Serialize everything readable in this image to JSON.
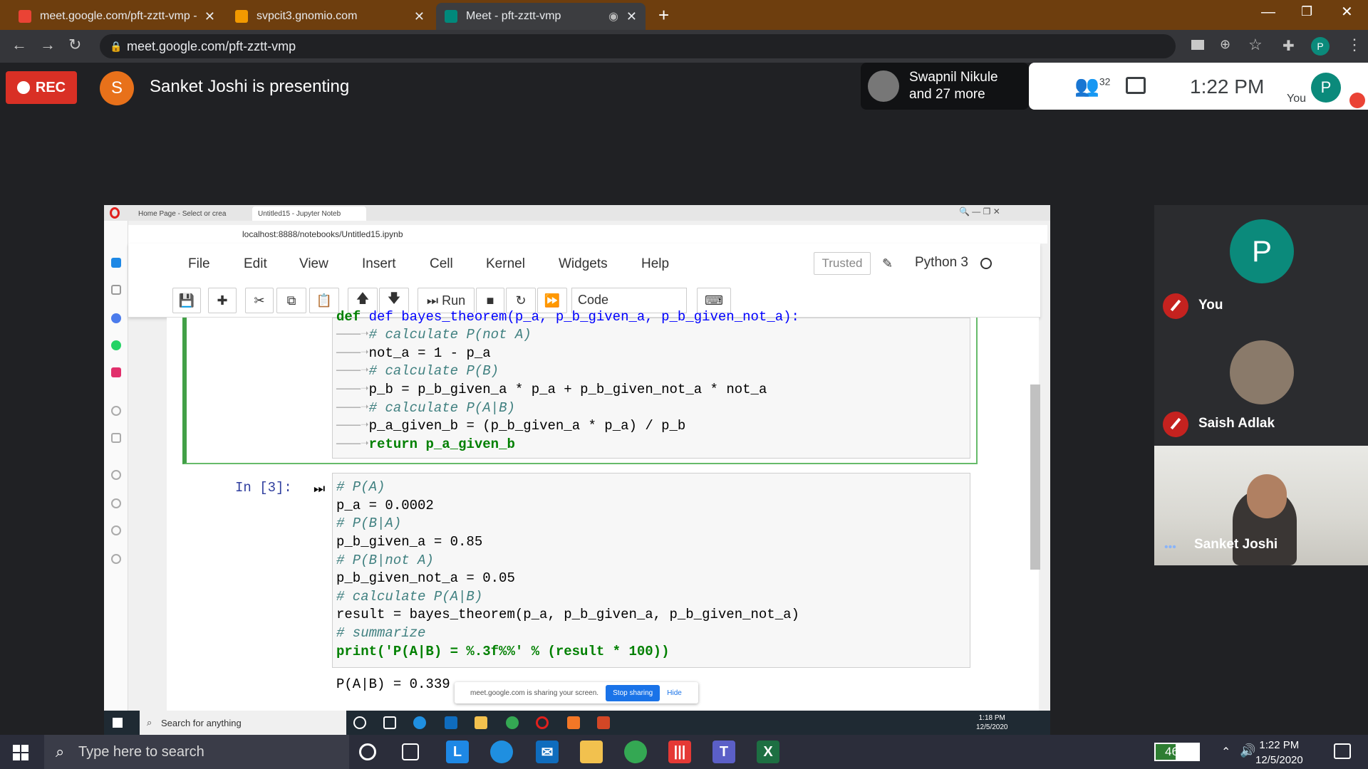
{
  "browser": {
    "tabs": [
      {
        "label": "meet.google.com/pft-zztt-vmp -",
        "active": false
      },
      {
        "label": "svpcit3.gnomio.com",
        "active": false
      },
      {
        "label": "Meet - pft-zztt-vmp",
        "active": true
      }
    ],
    "url": "meet.google.com/pft-zztt-vmp"
  },
  "meet": {
    "rec_label": "REC",
    "presenter_initial": "S",
    "presenter_text": "Sanket Joshi is presenting",
    "participants_preview": {
      "line1": "Swapnil Nikule",
      "line2": "and 27 more"
    },
    "participant_count": "32",
    "time": "1:22 PM",
    "you_label": "You",
    "you_initial": "P",
    "tiles": [
      {
        "name": "You",
        "initial": "P",
        "muted": true
      },
      {
        "name": "Saish Adlak",
        "muted": true
      },
      {
        "name": "Sanket Joshi",
        "video": true
      }
    ]
  },
  "shared": {
    "inner_tabs": [
      "Home Page - Select or crea",
      "Untitled15 - Jupyter Noteb"
    ],
    "inner_url": "localhost:8888/notebooks/Untitled15.ipynb",
    "menu": [
      "File",
      "Edit",
      "View",
      "Insert",
      "Cell",
      "Kernel",
      "Widgets",
      "Help"
    ],
    "trusted": "Trusted",
    "kernel": "Python 3",
    "run_label": "Run",
    "cell_type": "Code",
    "prompt": "In [3]:",
    "cell1_lines": [
      "def bayes_theorem(p_a, p_b_given_a, p_b_given_not_a):",
      "# calculate P(not A)",
      "not_a = 1 - p_a",
      "# calculate P(B)",
      "p_b = p_b_given_a * p_a + p_b_given_not_a * not_a",
      "# calculate P(A|B)",
      "p_a_given_b = (p_b_given_a * p_a) / p_b",
      "return p_a_given_b"
    ],
    "cell2_lines": [
      "# P(A)",
      "p_a = 0.0002",
      "# P(B|A)",
      "p_b_given_a = 0.85",
      "# P(B|not A)",
      "p_b_given_not_a = 0.05",
      "# calculate P(A|B)",
      "result = bayes_theorem(p_a, p_b_given_a, p_b_given_not_a)",
      "# summarize",
      "print('P(A|B) = %.3f%%' % (result * 100))"
    ],
    "output": "P(A|B) = 0.339",
    "share_bar": {
      "text": "meet.google.com is sharing your screen.",
      "stop": "Stop sharing",
      "hide": "Hide"
    },
    "inner_search": "Search for anything",
    "inner_time": "1:18 PM",
    "inner_date": "12/5/2020"
  },
  "taskbar": {
    "search_placeholder": "Type here to search",
    "battery": "46%",
    "battery_level": 0.46,
    "time": "1:22 PM",
    "date": "12/5/2020"
  },
  "colors": {
    "rec": "#d93025",
    "presenter": "#e8711a",
    "you_avatar": "#0b8a7b",
    "cell_border": "#42a047"
  }
}
